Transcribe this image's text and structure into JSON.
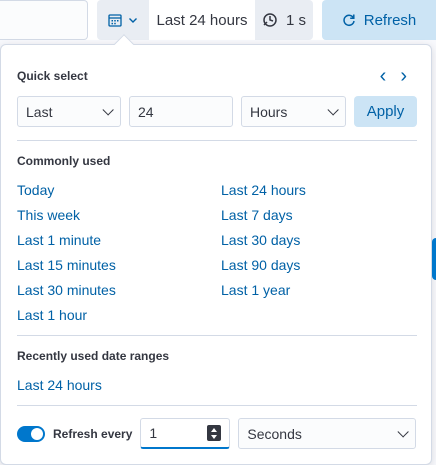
{
  "topbar": {
    "date_label": "Last 24 hours",
    "interval_label": "1 s",
    "refresh_label": "Refresh"
  },
  "quick_select": {
    "title": "Quick select",
    "tense": "Last",
    "value": "24",
    "unit": "Hours",
    "apply_label": "Apply"
  },
  "commonly_used": {
    "title": "Commonly used",
    "left": [
      "Today",
      "This week",
      "Last 1 minute",
      "Last 15 minutes",
      "Last 30 minutes",
      "Last 1 hour"
    ],
    "right": [
      "Last 24 hours",
      "Last 7 days",
      "Last 30 days",
      "Last 90 days",
      "Last 1 year"
    ]
  },
  "recent": {
    "title": "Recently used date ranges",
    "items": [
      "Last 24 hours"
    ]
  },
  "refresh": {
    "label": "Refresh every",
    "value": "1",
    "unit": "Seconds",
    "enabled": true
  },
  "colors": {
    "accent": "#0077cc",
    "link": "#0061a6",
    "button_bg": "#cce4f5"
  }
}
